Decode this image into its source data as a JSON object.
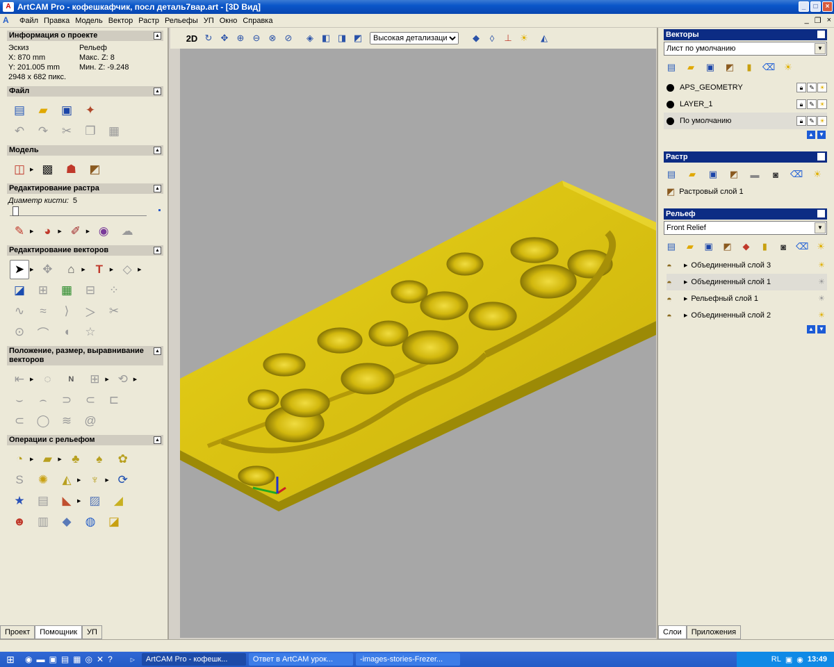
{
  "window": {
    "title": "ArtCAM Pro - кофешкафчик, посл деталь7вар.art - [3D Вид]"
  },
  "menu": [
    "Файл",
    "Правка",
    "Модель",
    "Вектор",
    "Растр",
    "Рельефы",
    "УП",
    "Окно",
    "Справка"
  ],
  "left": {
    "project_info": {
      "title": "Информация о проекте",
      "sketch_label": "Эскиз",
      "x": "X: 870 mm",
      "y": "Y: 201.005 mm",
      "pixels": "2948 x 682 пикс.",
      "relief_label": "Рельеф",
      "max_z": "Макс. Z: 8",
      "min_z": "Мин. Z: -9.248"
    },
    "file_title": "Файл",
    "model_title": "Модель",
    "raster_edit": {
      "title": "Редактирование растра",
      "brush_label": "Диаметр кисти:",
      "brush_value": "5"
    },
    "vector_edit_title": "Редактирование векторов",
    "position_title": "Положение, размер, выравнивание векторов",
    "relief_ops_title": "Операции с рельефом",
    "tabs": [
      "Проект",
      "Помощник",
      "УП"
    ]
  },
  "toolbar": {
    "mode": "2D",
    "detail": "Высокая детализация"
  },
  "right": {
    "vectors": {
      "title": "Векторы",
      "sheet": "Лист по умолчанию",
      "layers": [
        "APS_GEOMETRY",
        "LAYER_1",
        "По умолчанию"
      ]
    },
    "raster": {
      "title": "Растр",
      "layer": "Растровый слой 1"
    },
    "relief": {
      "title": "Рельеф",
      "view": "Front Relief",
      "layers": [
        "Объединенный слой 3",
        "Объединенный слой 1",
        "Рельефный слой 1",
        "Объединенный слой 2"
      ]
    },
    "tabs": [
      "Слои",
      "Приложения"
    ]
  },
  "taskbar": {
    "items": [
      "ArtCAM Pro - кофешк...",
      "Ответ в ArtCAM урок...",
      "-images-stories-Frezer..."
    ],
    "lang": "RL",
    "time": "13:49"
  },
  "colors": {
    "relief": "#d6bf0a",
    "panel": "#ece9d8",
    "header_blue": "#0c2c84"
  }
}
